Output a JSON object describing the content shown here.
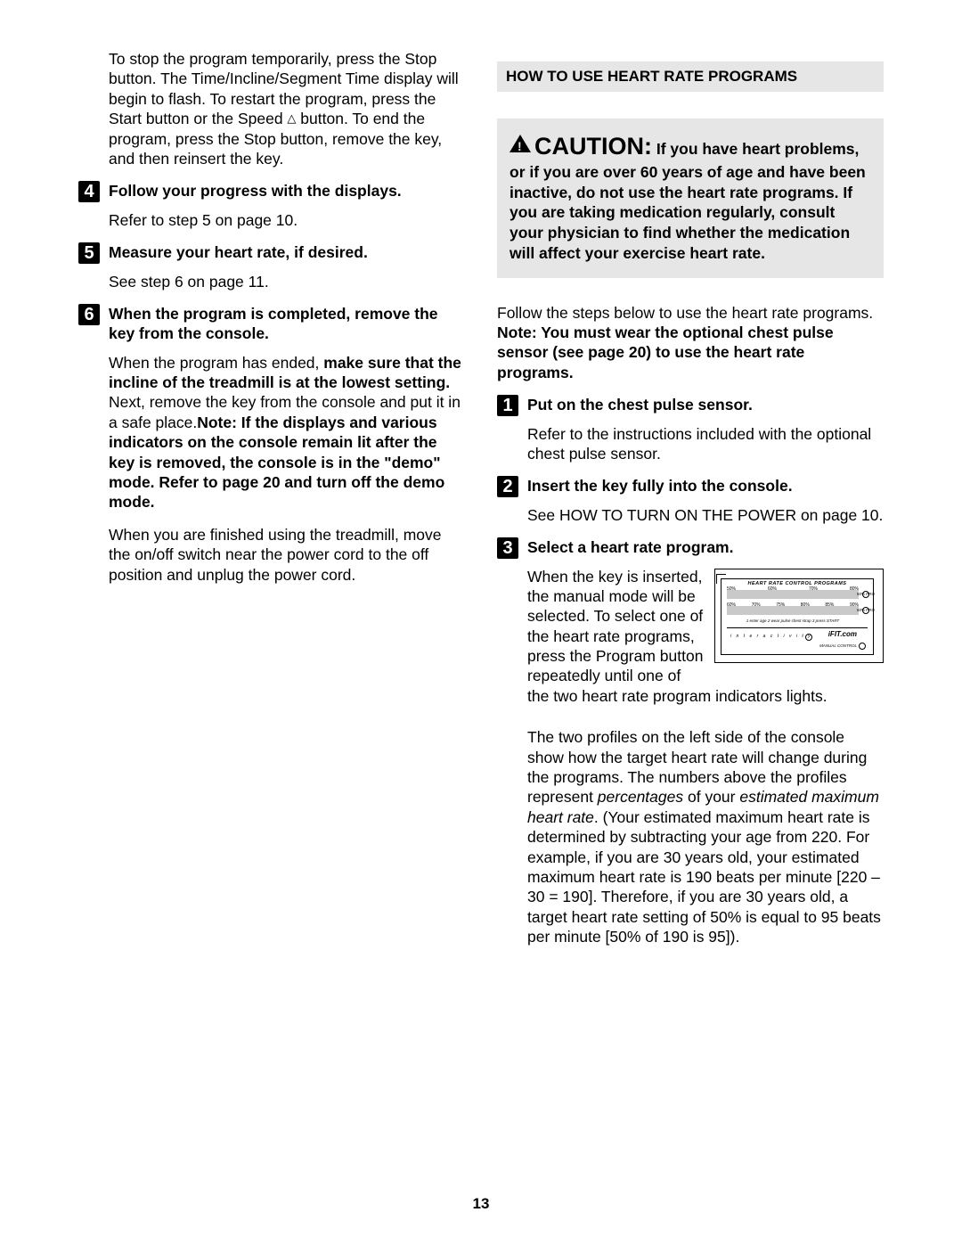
{
  "page_number": "13",
  "left": {
    "intro_pre": "To stop the program temporarily, press the Stop button. The Time/Incline/Segment Time display will begin to flash. To restart the program, press the Start button or the Speed ",
    "intro_post": " button. To end the program, press the Stop button, remove the key, and then reinsert the key.",
    "step4": {
      "num": "4",
      "head": "Follow your progress with the displays.",
      "body": "Refer to step 5 on page 10."
    },
    "step5": {
      "num": "5",
      "head": "Measure your heart rate, if desired.",
      "body": "See step 6 on page 11."
    },
    "step6": {
      "num": "6",
      "head": "When the program is completed, remove the key from the console.",
      "p1_a": "When the program has ended, ",
      "p1_b": "make sure that the incline of the treadmill is at the lowest setting.",
      "p1_c": " Next, remove the key from the console and put it in a safe place.",
      "p1_d": "Note: If the displays and various indicators on the console remain lit after the key is removed, the console is in the \"demo\" mode. Refer to page 20 and turn off the demo mode.",
      "p2": "When you are finished using the treadmill, move the on/off switch near the power cord to the off position and unplug the power cord."
    }
  },
  "right": {
    "section_title": "HOW TO USE HEART RATE PROGRAMS",
    "caution_word": "CAUTION:",
    "caution_body": " If you have heart problems, or if you are over 60 years of age and have been inactive, do not use the heart rate programs. If you are taking medication regularly, consult your physician to find whether the medication will affect your exercise heart rate.",
    "intro_a": "Follow the steps below to use the heart rate programs. ",
    "intro_b": "Note: You must wear the optional chest pulse sensor (see page 20) to use the heart rate programs.",
    "step1": {
      "num": "1",
      "head": "Put on the chest pulse sensor.",
      "body": "Refer to the instructions included with the optional chest pulse sensor."
    },
    "step2": {
      "num": "2",
      "head": "Insert the key fully into the console.",
      "body": "See HOW TO TURN ON THE POWER on page 10."
    },
    "step3": {
      "num": "3",
      "head": "Select a heart rate program.",
      "p1": "When the key is inserted, the manual mode will be selected. To select one of the heart rate programs, press the Program button repeatedly until one of the two heart rate program indicators lights.",
      "p2_a": "The two profiles on the left side of the console show how the target heart rate will change during the programs. The numbers above the profiles represent ",
      "p2_b": "percentages",
      "p2_c": " of your ",
      "p2_d": "estimated maximum heart rate",
      "p2_e": ". (Your estimated maximum heart rate is determined by subtracting your age from 220. For example, if you are 30 years old, your estimated maximum heart rate is 190 beats per minute [220 – 30 = 190]. Therefore, if you are 30 years old, a target heart rate setting of 50% is equal to 95 beats per minute [50% of 190 is 95])."
    }
  },
  "figure": {
    "title": "HEART RATE CONTROL PROGRAMS",
    "row1": [
      "50%",
      "60%",
      "70%",
      "80%"
    ],
    "row1_suffix": "50% PRO",
    "row2": [
      "60%",
      "70%",
      "75%",
      "80%",
      "85%",
      "90%"
    ],
    "row2_suffix": "60% PRO",
    "instruct": "1 enter age  2 wear pulse chest strap  3 press START",
    "interactivity": "i n t e r a c t i v i t y",
    "ifit": "iFIT.com",
    "manual": "MANUAL CONTROL"
  }
}
